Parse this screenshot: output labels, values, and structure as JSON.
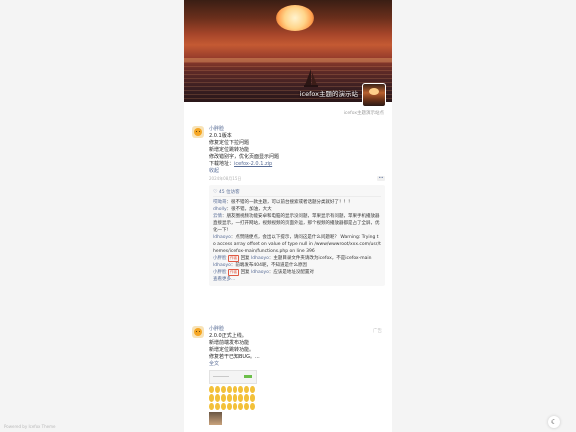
{
  "cover": {
    "title": "icefox主题的演示站",
    "subtitle": "icefox主题演示站点"
  },
  "posts": [
    {
      "author": "小胖脸",
      "lines": [
        "2.0.1版本",
        "修复定位下拉问题",
        "新增定位跳转功能",
        "修改错别字，优化页面显示问题"
      ],
      "download_label": "下载地址：",
      "download_link": "icefox-2.0.1.zip",
      "collapse": "收起",
      "date": "2024年08月15日",
      "likes_count": "45",
      "likes_label": "45 位访客",
      "comments": [
        {
          "author": "哎呦哥",
          "text": "：很不错的一款主题，可以前台搜索或者话题分类就好了！！！"
        },
        {
          "author": "dholly",
          "text": "：很不错，加油，大大"
        },
        {
          "author": "云情",
          "text": "：朋友圈视频功能安卓和电脑的显示没问题，苹果显示有问题，苹果手机播放器直接显示，一打开网站，视频视频的页面外运，那个视频的播放器都是占了全屏，优化一下!"
        },
        {
          "author": "ldhaoyo",
          "text": "：点赞随便点，会出以下提示，请问这是什么问题呢？ Warning: Trying to access array offset on value of type null in /www/wwwroot/xxx.com/usr/themes/icefox-main/functions.php on line 396"
        },
        {
          "author": "小胖脸",
          "tag": "作者",
          "reply_word": "回复",
          "reply_to": "ldhaoyo",
          "text": "：主题目录文件夹请改为icefox，不是icefox-main"
        },
        {
          "author": "ldhaoyo",
          "text": "：前端发布404呢，不知道是什么原因"
        },
        {
          "author": "小胖脸",
          "tag": "作者",
          "reply_word": "回复",
          "reply_to": "ldhaoyo",
          "text": "：应该是地址没配置对"
        }
      ],
      "more_comments": "查看更多..."
    },
    {
      "author": "小胖脸",
      "lines": [
        "2.0.0正式上线。",
        "新增前端发布功能",
        "新增定位跳转功能。",
        "修复若干已知BUG。..."
      ],
      "fulltext": "全文",
      "corner_label": "广告"
    }
  ],
  "footer": "Powered by Icefox Theme",
  "theme_toggle": "☾"
}
